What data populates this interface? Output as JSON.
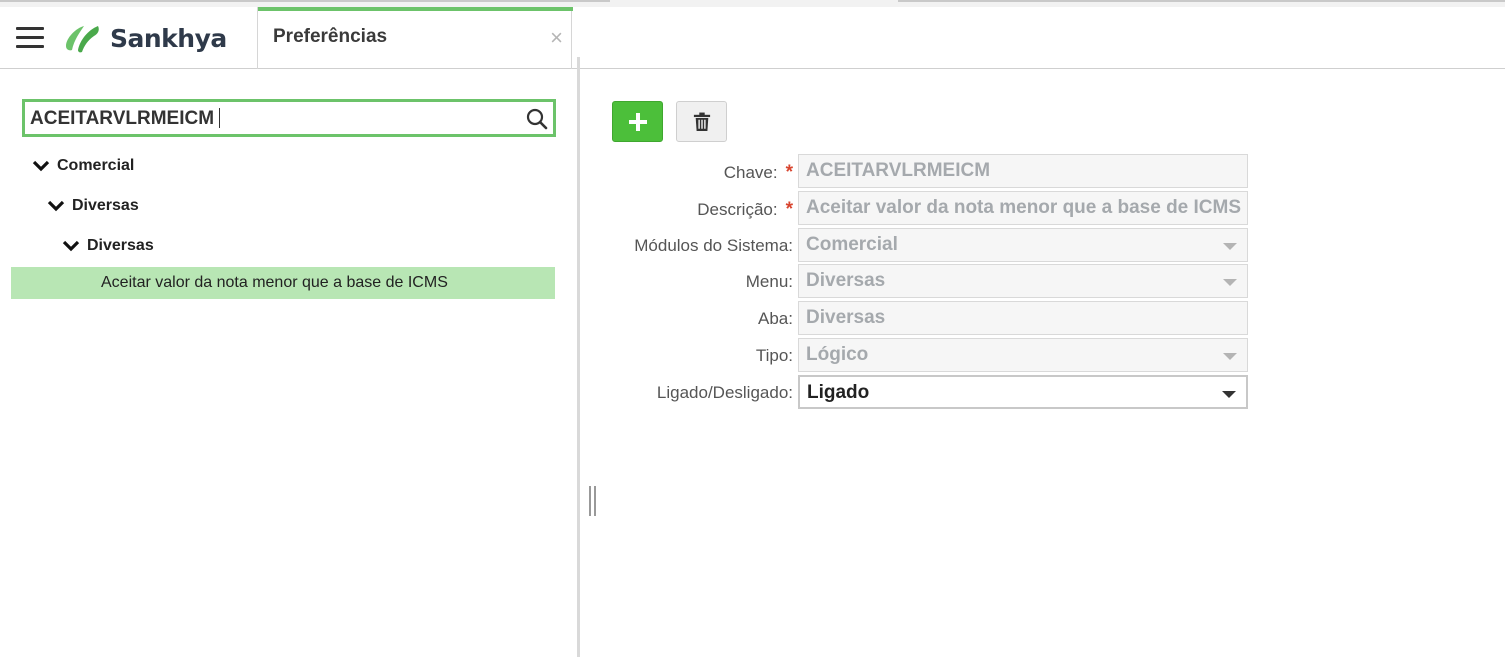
{
  "app": {
    "logo_text": "Sankhya",
    "accent_color": "#6cc36a"
  },
  "tab": {
    "title": "Preferências",
    "close_glyph": "×"
  },
  "search": {
    "value": "ACEITARVLRMEICM"
  },
  "tree": {
    "nodes": [
      {
        "label": "Comercial"
      },
      {
        "label": "Diversas"
      },
      {
        "label": "Diversas"
      }
    ],
    "selected_leaf": "Aceitar valor da nota menor que a base de ICMS"
  },
  "toolbar": {
    "add_icon": "plus-icon",
    "delete_icon": "trash-icon"
  },
  "form": {
    "chave": {
      "label": "Chave:",
      "required": "*",
      "value": "ACEITARVLRMEICM"
    },
    "descricao": {
      "label": "Descrição:",
      "required": "*",
      "value": "Aceitar valor da nota menor que a base de ICMS"
    },
    "modulos": {
      "label": "Módulos do Sistema:",
      "value": "Comercial"
    },
    "menu": {
      "label": "Menu:",
      "value": "Diversas"
    },
    "aba": {
      "label": "Aba:",
      "value": "Diversas"
    },
    "tipo": {
      "label": "Tipo:",
      "value": "Lógico"
    },
    "ligado": {
      "label": "Ligado/Desligado:",
      "value": "Ligado"
    }
  }
}
